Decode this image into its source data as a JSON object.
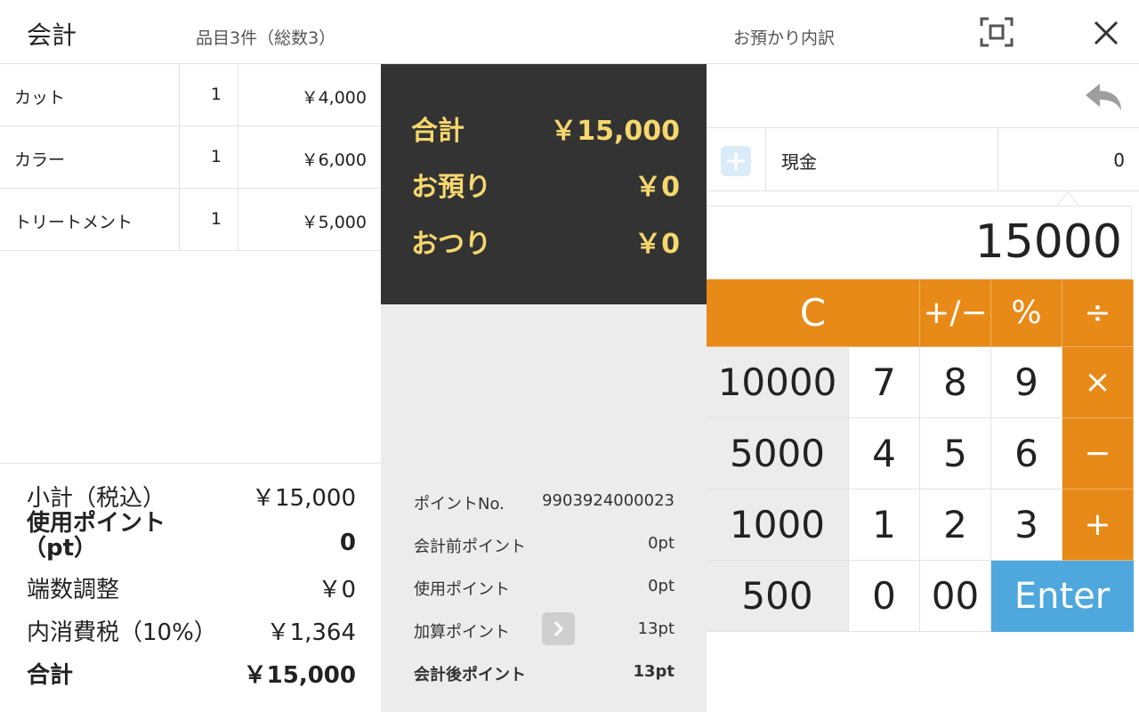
{
  "header": {
    "title": "会計",
    "item_count": "品目3件（総数3）",
    "breakdown_title": "お預かり内訳"
  },
  "items": [
    {
      "name": "カット",
      "qty": "1",
      "price": "￥4,000"
    },
    {
      "name": "カラー",
      "qty": "1",
      "price": "￥6,000"
    },
    {
      "name": "トリートメント",
      "qty": "1",
      "price": "￥5,000"
    }
  ],
  "summary": {
    "subtotal_label": "小計（税込）",
    "subtotal_value": "￥15,000",
    "used_points_label_1": "使用ポイント",
    "used_points_label_2": "（pt）",
    "used_points_value": "0",
    "rounding_label": "端数調整",
    "rounding_value": "￥0",
    "tax_label": "内消費税（10%）",
    "tax_value": "￥1,364",
    "total_label": "合計",
    "total_value": "￥15,000"
  },
  "totals_box": {
    "total_label": "合計",
    "total_value": "￥15,000",
    "deposit_label": "お預り",
    "deposit_value": "￥0",
    "change_label": "おつり",
    "change_value": "￥0"
  },
  "points": {
    "number_label": "ポイントNo.",
    "number_value": "9903924000023",
    "before_label": "会計前ポイント",
    "before_value": "0pt",
    "used_label": "使用ポイント",
    "used_value": "0pt",
    "added_label": "加算ポイント",
    "added_value": "13pt",
    "after_label": "会計後ポイント",
    "after_value": "13pt"
  },
  "payment": {
    "method": "現金",
    "amount": "0"
  },
  "calculator": {
    "display": "15000",
    "keys": {
      "clear": "C",
      "plus_minus": "+/−",
      "percent": "%",
      "divide": "÷",
      "k10000": "10000",
      "k7": "7",
      "k8": "8",
      "k9": "9",
      "multiply": "×",
      "k5000": "5000",
      "k4": "4",
      "k5": "5",
      "k6": "6",
      "minus": "−",
      "k1000": "1000",
      "k1": "1",
      "k2": "2",
      "k3": "3",
      "plus": "+",
      "k500": "500",
      "k0": "0",
      "k00": "00",
      "enter": "Enter"
    }
  },
  "icons": {
    "expand": "expand-icon",
    "close": "close-icon",
    "undo": "undo-icon",
    "add": "plus-icon",
    "chevron": "chevron-right-icon"
  },
  "colors": {
    "orange": "#e88a17",
    "blue": "#4ea8de",
    "dark": "#333333",
    "gold": "#f5d76e"
  }
}
